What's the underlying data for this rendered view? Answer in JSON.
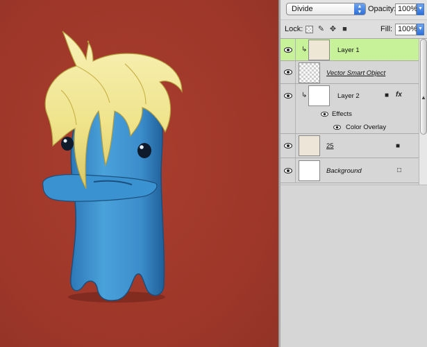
{
  "blend": {
    "mode": "Divide",
    "opacity_label": "Opacity:",
    "opacity_value": "100%"
  },
  "lock": {
    "label": "Lock:",
    "fill_label": "Fill:",
    "fill_value": "100%"
  },
  "layers": [
    {
      "name": "Layer 1",
      "selected": true,
      "visible": true,
      "thumb": "beige-texture",
      "clipped": true
    },
    {
      "name": "Vector Smart Object",
      "selected": false,
      "visible": true,
      "thumb": "transparent-checker"
    },
    {
      "name": "Layer 2",
      "selected": false,
      "visible": true,
      "thumb": "white",
      "clipped": true,
      "locked": true,
      "has_fx": true
    },
    {
      "name": "Effects",
      "sub": true
    },
    {
      "name": "Color Overlay",
      "sub": true
    },
    {
      "name": "25",
      "selected": false,
      "visible": true,
      "thumb": "beige-texture",
      "locked": true
    },
    {
      "name": "Background",
      "selected": false,
      "visible": true,
      "thumb": "white",
      "locked": true
    }
  ],
  "fx_label": "fx",
  "colors": {
    "selected_layer": "#c7f29a",
    "canvas_bg": "#a5392b",
    "monster": "#3a8fcf",
    "hair": "#f1e69a"
  },
  "icons": {
    "eye": "eye-icon",
    "lock": "lock-icon",
    "fx": "fx-icon",
    "clip": "clipping-arrow-icon",
    "dropdown": "dropdown-arrow-icon",
    "lock_transparent": "lock-transparent-pixels-icon",
    "lock_image": "lock-image-pixels-icon",
    "lock_position": "lock-position-icon",
    "lock_all": "lock-all-icon"
  }
}
